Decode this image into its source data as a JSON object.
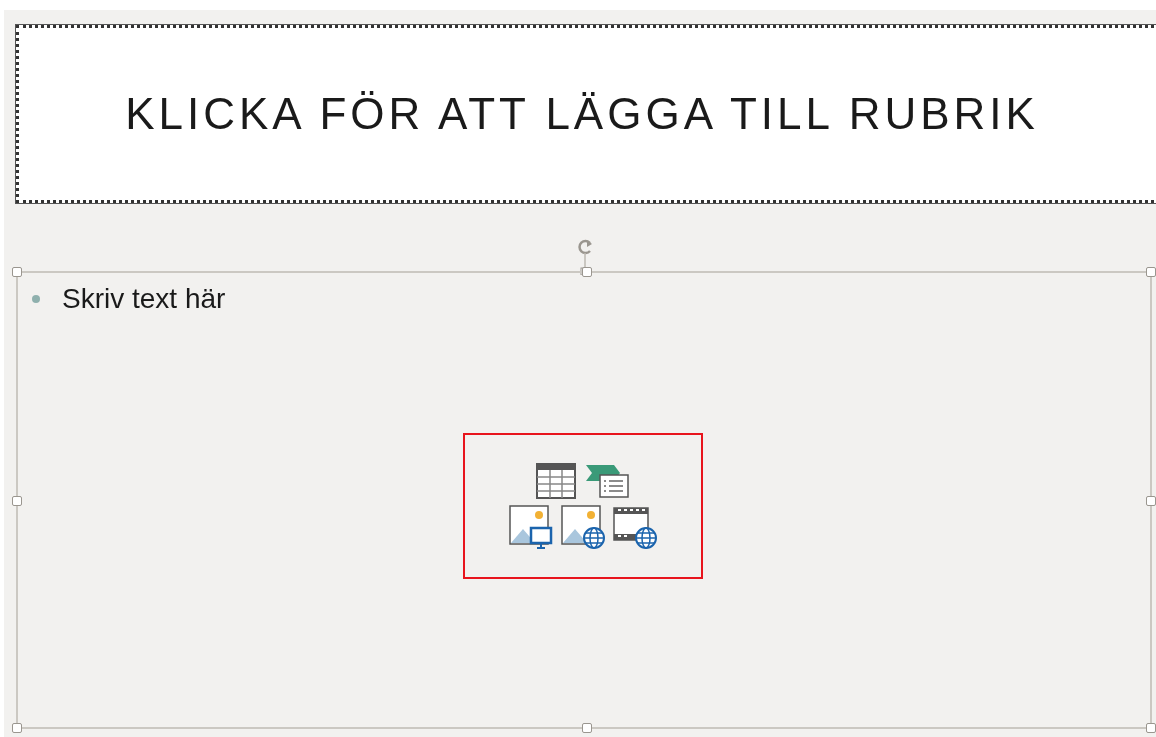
{
  "title_placeholder": {
    "text": "KLICKA FÖR ATT LÄGGA TILL RUBRIK"
  },
  "content_placeholder": {
    "bullets": [
      "Skriv text här"
    ]
  }
}
